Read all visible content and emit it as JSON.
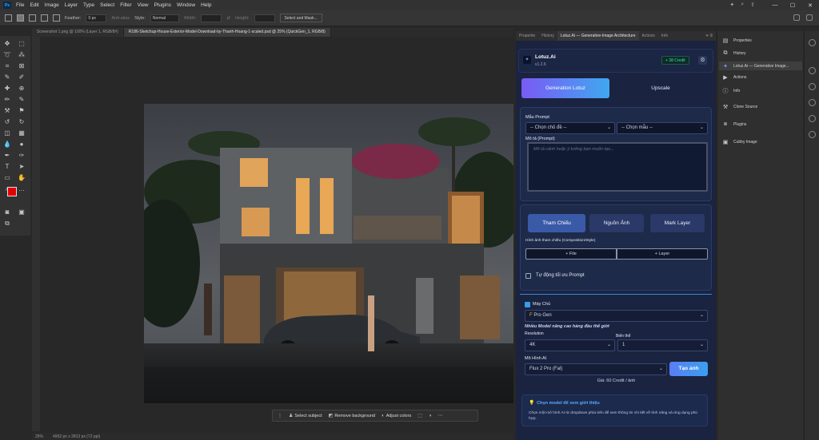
{
  "menubar": {
    "app_icon": "Ps",
    "items": [
      "File",
      "Edit",
      "Image",
      "Layer",
      "Type",
      "Select",
      "Filter",
      "View",
      "Plugins",
      "Window",
      "Help"
    ]
  },
  "options": {
    "feather_label": "Feather:",
    "feather_value": "0 px",
    "antialias_label": "Anti-alias",
    "style_label": "Style:",
    "style_value": "Normal",
    "width_label": "Width:",
    "height_label": "Height:",
    "select_mask_label": "Select and Mask..."
  },
  "doc_tabs": [
    "Screenshot 1.png @ 100% (Layer 1, RGB/8#)",
    "R186-Sketchup-House-Exterior-Model-Download-by-Thanh-Hoang-1-scaled.psd @ 25% (QuickGen_1, RGB/8)"
  ],
  "context_bar": {
    "select_subject": "Select subject",
    "remove_background": "Remove background",
    "adjust_colors": "Adjust colors"
  },
  "status": {
    "zoom": "25%",
    "dimensions": "4952 px x 2813 px (72 ppi)"
  },
  "panel_tabs": [
    "Propertie",
    "History",
    "Lotuz.Ai — Generative-Image Architecture",
    "Actions",
    "Info"
  ],
  "plugin": {
    "title": "Lotuz.Ai",
    "version": "v1.2.6",
    "credits": "+ 38 Credit",
    "tabs": {
      "generate": "Generation Lotuz",
      "upscale": "Upscale"
    },
    "prompt_template_label": "Mẫu Prompt",
    "topic_select": "-- Chọn chủ đề --",
    "template_select": "-- Chọn mẫu --",
    "prompt_label": "Mô tả (Prompt)",
    "prompt_placeholder": "Mô tả cảnh hoặc ý tưởng bạn muốn tạo...",
    "ref_tabs": {
      "reference": "Tham Chiếu",
      "source": "Nguồn Ảnh",
      "mark": "Mark Layer"
    },
    "ref_label": "Hình ảnh tham chiếu (Composition/Style)",
    "add_file": "+ File",
    "add_layer": "+ Layer",
    "auto_optimize": "Tự động tối ưu Prompt",
    "server_label": "Máy Chủ",
    "server_value": "Pro Gen",
    "server_note": "Nhiều Model nâng cao hàng đầu thế giới",
    "resolution_label": "Resolution",
    "resolution_value": "4K",
    "variants_label": "Biến thể",
    "variants_value": "1",
    "model_label": "Mô Hình AI",
    "model_value": "Flux 2 Pro (Fal)",
    "generate_button": "Tạo ảnh",
    "price": "Giá: 60 Credit / ảnh",
    "info_title": "Chọn model để xem giới thiệu",
    "info_text": "Chọn một mô hình AI từ dropdown phía trên để xem thông tin chi tiết về tính năng và ứng dụng phù hợp."
  },
  "right_panel": {
    "items": [
      "Properties",
      "History",
      "Lotuz.Ai — Generative Image...",
      "Actions",
      "Info",
      "Clone Source",
      "Plugins",
      "Cubby Image"
    ]
  }
}
